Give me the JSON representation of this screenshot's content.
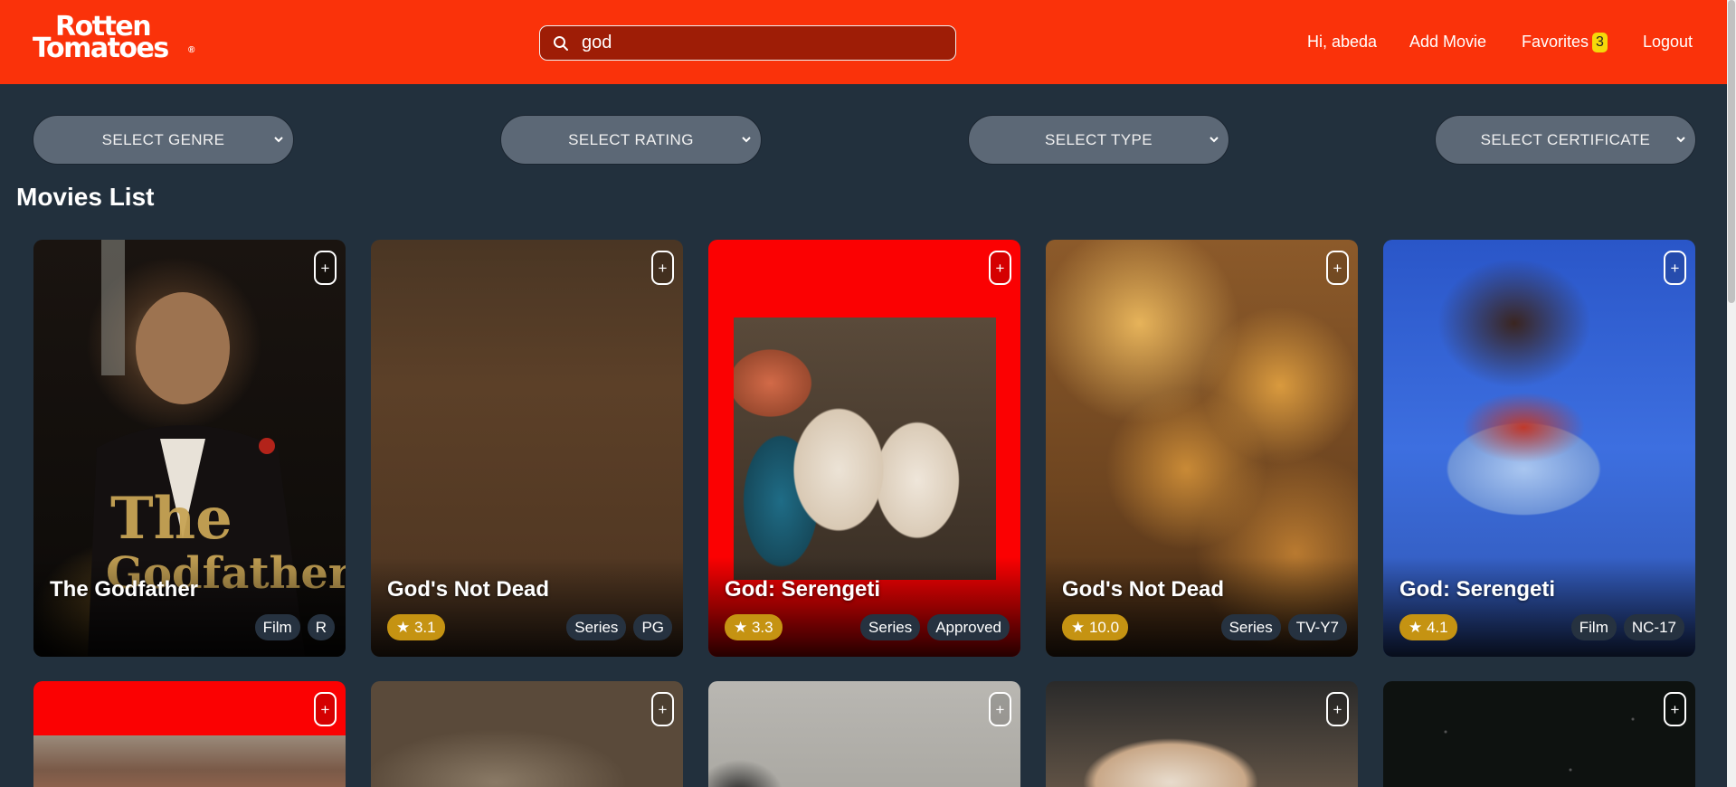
{
  "header": {
    "logo_line1": "Rotten",
    "logo_line2": "Tomatoes",
    "logo_mark": "®",
    "search_value": "god",
    "nav": {
      "greeting": "Hi, abeda",
      "add_movie": "Add Movie",
      "favorites": "Favorites",
      "favorites_count": "3",
      "logout": "Logout"
    }
  },
  "filters": {
    "genre": "SELECT GENRE",
    "rating": "SELECT RATING",
    "type": "SELECT TYPE",
    "certificate": "SELECT CERTIFICATE"
  },
  "section_title": "Movies List",
  "movies": [
    {
      "title": "The Godfather",
      "rating": "",
      "type": "Film",
      "certificate": "R",
      "add": "+"
    },
    {
      "title": "God's Not Dead",
      "rating": "★ 3.1",
      "type": "Series",
      "certificate": "PG",
      "add": "+"
    },
    {
      "title": "God: Serengeti",
      "rating": "★ 3.3",
      "type": "Series",
      "certificate": "Approved",
      "add": "+"
    },
    {
      "title": "God's Not Dead",
      "rating": "★ 10.0",
      "type": "Series",
      "certificate": "TV-Y7",
      "add": "+"
    },
    {
      "title": "God: Serengeti",
      "rating": "★ 4.1",
      "type": "Film",
      "certificate": "NC-17",
      "add": "+"
    }
  ],
  "row2": [
    {
      "add": "+"
    },
    {
      "add": "+"
    },
    {
      "add": "+"
    },
    {
      "add": "+"
    },
    {
      "add": "+"
    }
  ],
  "colors": {
    "brand": "#fa320a",
    "background": "#22303d",
    "rating_badge": "#c59312",
    "favorites_badge": "#f5d90a"
  }
}
